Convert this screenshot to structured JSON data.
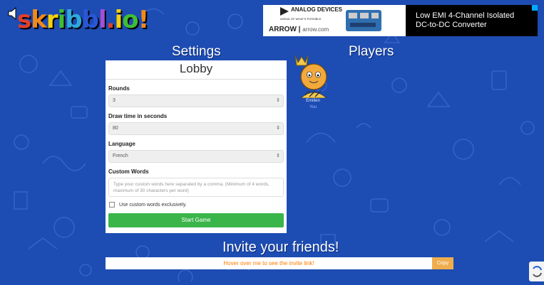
{
  "app": {
    "logo_letters": [
      "s",
      "k",
      "r",
      "i",
      "b",
      "b",
      "l",
      ".",
      "i",
      "o",
      "!"
    ],
    "logo_colors": [
      "#e33e2b",
      "#f08a1a",
      "#f4d20b",
      "#3fbd35",
      "#2fa8de",
      "#2a57d6",
      "#a54fd6",
      "#e33e2b",
      "#f4d20b",
      "#3fbd35",
      "#f08a1a"
    ]
  },
  "ad": {
    "brand_name": "ANALOG DEVICES",
    "brand_sub": "AHEAD OF WHAT'S POSSIBLE",
    "arrow_brand": "ARROW",
    "arrow_url": "arrow.com",
    "headline": "Low EMI 4-Channel Isolated DC-to-DC Converter"
  },
  "settings": {
    "heading": "Settings",
    "panel_title": "Lobby",
    "rounds_label": "Rounds",
    "rounds_value": "3",
    "drawtime_label": "Draw time in seconds",
    "drawtime_value": "80",
    "language_label": "Language",
    "language_value": "French",
    "custom_words_label": "Custom Words",
    "custom_words_placeholder": "Type your custom words here separated by a comma. (Minimum of 4 words, maximum of 30 characters per word)",
    "exclusive_label": "Use custom words exclusively.",
    "exclusive_checked": false,
    "start_label": "Start Game"
  },
  "players": {
    "heading": "Players",
    "list": [
      {
        "name": "Emilien",
        "tag": "You"
      }
    ]
  },
  "invite": {
    "title": "Invite your friends!",
    "link_text": "Hover over me to see the invite link!",
    "copy_label": "Copy"
  },
  "colors": {
    "background": "#1d4cb3",
    "start_button": "#3ab54a",
    "copy_button": "#f0ad4e",
    "invite_text": "#ff7a00"
  }
}
